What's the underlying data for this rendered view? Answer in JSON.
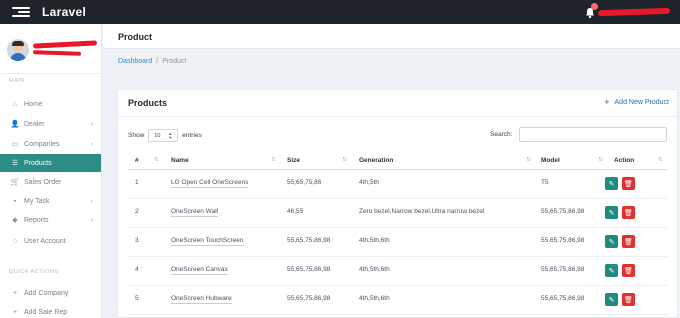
{
  "app": {
    "brand": "Laravel"
  },
  "sidebar": {
    "main_label": "MAIN",
    "items": [
      {
        "label": "Home",
        "icon": "home-icon",
        "has_chevron": false,
        "active": false
      },
      {
        "label": "Dealer",
        "icon": "users-icon",
        "has_chevron": true,
        "active": false
      },
      {
        "label": "Companies",
        "icon": "building-icon",
        "has_chevron": true,
        "active": false
      },
      {
        "label": "Products",
        "icon": "list-icon",
        "has_chevron": false,
        "active": true
      },
      {
        "label": "Sales Order",
        "icon": "cart-icon",
        "has_chevron": false,
        "active": false
      },
      {
        "label": "My Task",
        "icon": "briefcase-icon",
        "has_chevron": true,
        "active": false
      },
      {
        "label": "Reports",
        "icon": "tag-icon",
        "has_chevron": true,
        "active": false
      },
      {
        "label": "User Account",
        "icon": "user-icon",
        "has_chevron": false,
        "active": false
      }
    ],
    "quick_label": "QUICK ACTIONS",
    "quick_actions": [
      {
        "label": "Add Company"
      },
      {
        "label": "Add Sale Rep"
      }
    ]
  },
  "header": {
    "title": "Product"
  },
  "breadcrumb": {
    "link": "Dashboard",
    "separator": "/",
    "current": "Product"
  },
  "card": {
    "title": "Products",
    "add_new": "Add New Product",
    "show_label": "Show",
    "entries_value": "10",
    "entries_label": "entries",
    "search_label": "Search:",
    "search_value": ""
  },
  "table": {
    "columns": [
      "#",
      "Name",
      "Size",
      "Generation",
      "Model",
      "Action"
    ],
    "rows": [
      {
        "id": "1",
        "name": "LG Open Cell OneScreens",
        "size": "55,65,75,86",
        "generation": "4th,5th",
        "model": "T5"
      },
      {
        "id": "2",
        "name": "OneScreen Wall",
        "size": "46,55",
        "generation": "Zero bezel,Narrow bezel,Ultra narrow bezel",
        "model": "55,65,75,86,98"
      },
      {
        "id": "3",
        "name": "OneScreen TouchScreen",
        "size": "55,65,75,86,98",
        "generation": "4th,5th,6th",
        "model": "55,65,75,86,98"
      },
      {
        "id": "4",
        "name": "OneScreen Canvas",
        "size": "55,65,75,86,98",
        "generation": "4th,5th,6th",
        "model": "55,65,75,86,98"
      },
      {
        "id": "5",
        "name": "OneScreen Hubware",
        "size": "55,65,75,86,98",
        "generation": "4th,5th,6th",
        "model": "55,65,75,86,98"
      }
    ]
  },
  "colors": {
    "topbar": "#1f232a",
    "accent": "#2c8c86",
    "edit": "#1f8c7e",
    "delete": "#e2302f",
    "link": "#2a8dbf"
  }
}
